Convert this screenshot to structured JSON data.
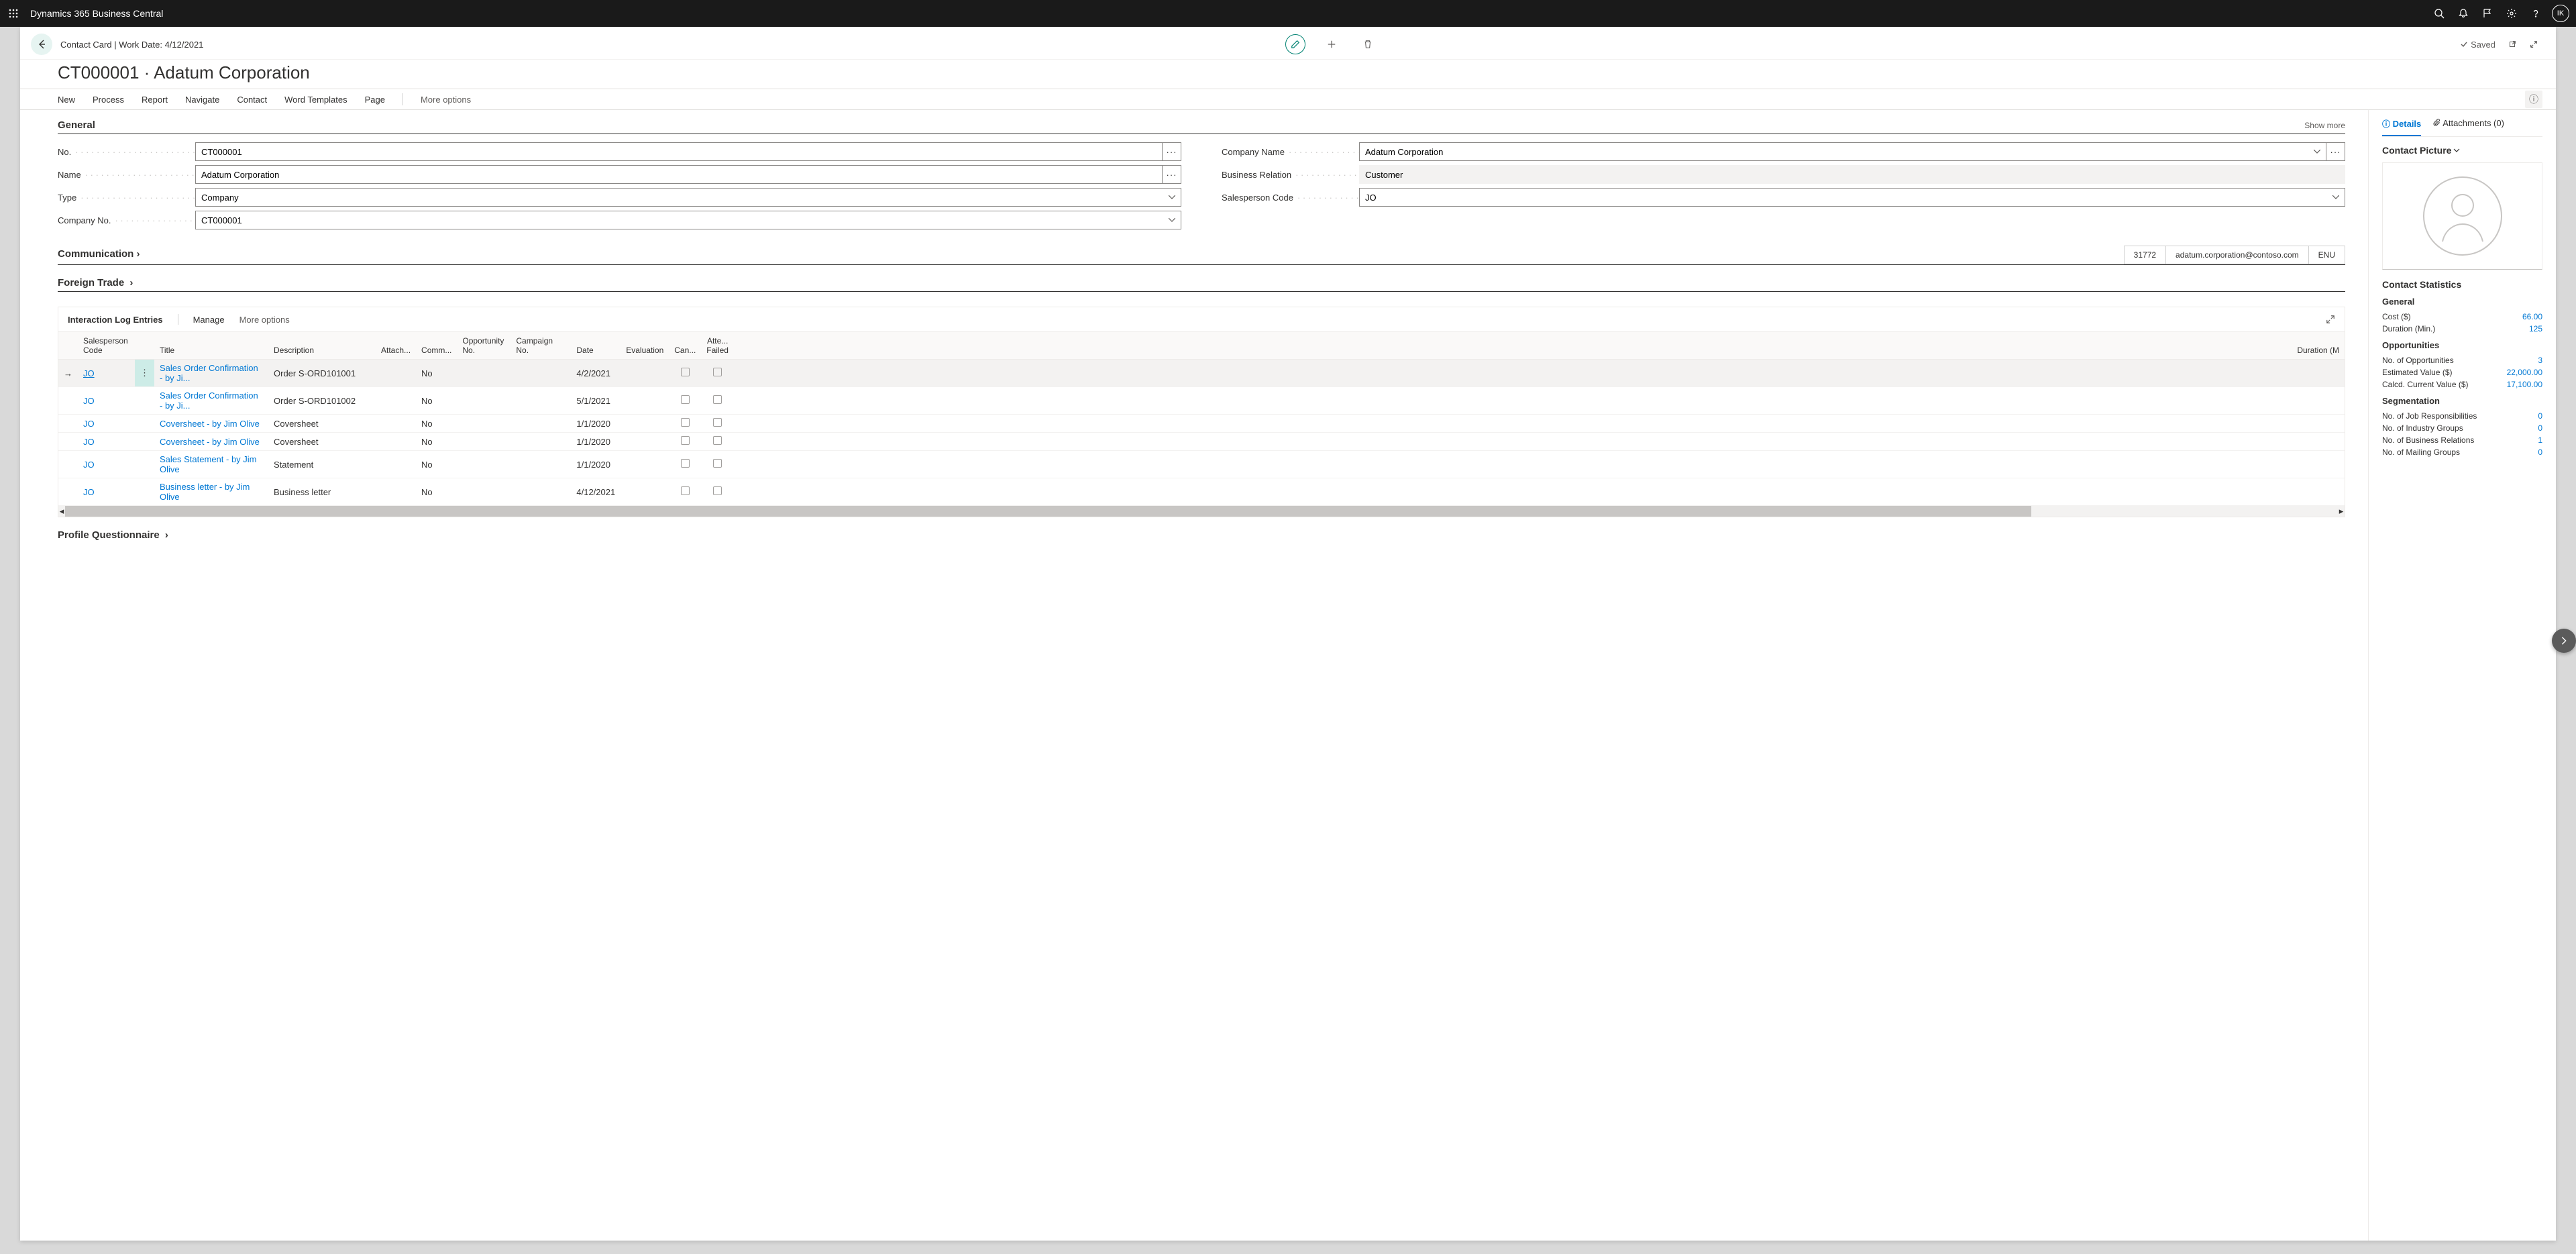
{
  "app_name": "Dynamics 365 Business Central",
  "avatar_initials": "IK",
  "breadcrumb": "Contact Card | Work Date: 4/12/2021",
  "saved_label": "Saved",
  "page_title": "CT000001 · Adatum Corporation",
  "actions": {
    "new": "New",
    "process": "Process",
    "report": "Report",
    "navigate": "Navigate",
    "contact": "Contact",
    "word_templates": "Word Templates",
    "page": "Page",
    "more_options": "More options"
  },
  "sections": {
    "general": "General",
    "show_more": "Show more",
    "communication": "Communication",
    "foreign_trade": "Foreign Trade",
    "interaction_log": "Interaction Log Entries",
    "profile_questionnaire": "Profile Questionnaire"
  },
  "general": {
    "no_label": "No.",
    "no_value": "CT000001",
    "name_label": "Name",
    "name_value": "Adatum Corporation",
    "type_label": "Type",
    "type_value": "Company",
    "company_no_label": "Company No.",
    "company_no_value": "CT000001",
    "company_name_label": "Company Name",
    "company_name_value": "Adatum Corporation",
    "business_relation_label": "Business Relation",
    "business_relation_value": "Customer",
    "salesperson_label": "Salesperson Code",
    "salesperson_value": "JO"
  },
  "communication": {
    "zip": "31772",
    "email": "adatum.corporation@contoso.com",
    "lang": "ENU"
  },
  "ilog": {
    "manage": "Manage",
    "more": "More options",
    "headers": {
      "salesperson": "Salesperson Code",
      "title": "Title",
      "description": "Description",
      "attach": "Attach...",
      "comm": "Comm...",
      "opportunity": "Opportunity No.",
      "campaign": "Campaign No.",
      "date": "Date",
      "evaluation": "Evaluation",
      "can": "Can...",
      "atte": "Atte... Failed",
      "duration": "Duration (M"
    },
    "rows": [
      {
        "sp": "JO",
        "title": "Sales Order Confirmation - by Ji...",
        "desc": "Order S-ORD101001",
        "comm": "No",
        "date": "4/2/2021"
      },
      {
        "sp": "JO",
        "title": "Sales Order Confirmation - by Ji...",
        "desc": "Order S-ORD101002",
        "comm": "No",
        "date": "5/1/2021"
      },
      {
        "sp": "JO",
        "title": "Coversheet - by Jim Olive",
        "desc": "Coversheet",
        "comm": "No",
        "date": "1/1/2020"
      },
      {
        "sp": "JO",
        "title": "Coversheet - by Jim Olive",
        "desc": "Coversheet",
        "comm": "No",
        "date": "1/1/2020"
      },
      {
        "sp": "JO",
        "title": "Sales Statement - by Jim Olive",
        "desc": "Statement",
        "comm": "No",
        "date": "1/1/2020"
      },
      {
        "sp": "JO",
        "title": "Business letter - by Jim Olive",
        "desc": "Business letter",
        "comm": "No",
        "date": "4/12/2021"
      }
    ]
  },
  "side": {
    "details_tab": "Details",
    "attachments_tab": "Attachments (0)",
    "contact_picture": "Contact Picture",
    "contact_statistics": "Contact Statistics",
    "general_h": "General",
    "cost_l": "Cost ($)",
    "cost_v": "66.00",
    "duration_l": "Duration (Min.)",
    "duration_v": "125",
    "opportunities_h": "Opportunities",
    "no_opp_l": "No. of Opportunities",
    "no_opp_v": "3",
    "est_val_l": "Estimated Value ($)",
    "est_val_v": "22,000.00",
    "calc_val_l": "Calcd. Current Value ($)",
    "calc_val_v": "17,100.00",
    "segmentation_h": "Segmentation",
    "job_resp_l": "No. of Job Responsibilities",
    "job_resp_v": "0",
    "ind_grp_l": "No. of Industry Groups",
    "ind_grp_v": "0",
    "bus_rel_l": "No. of Business Relations",
    "bus_rel_v": "1",
    "mail_grp_l": "No. of Mailing Groups",
    "mail_grp_v": "0"
  }
}
